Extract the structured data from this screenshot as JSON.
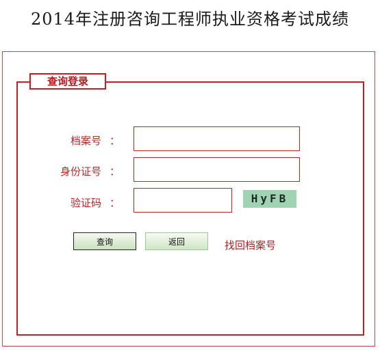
{
  "page": {
    "title": "2014年注册咨询工程师执业资格考试成绩"
  },
  "login": {
    "legend": "查询登录",
    "archive_label": "档案号",
    "id_label": "身份证号",
    "captcha_label": "验证码",
    "colon": "：",
    "archive_value": "",
    "id_value": "",
    "captcha_value": "",
    "captcha_text": "HyFB",
    "submit_label": "查询",
    "back_label": "返回",
    "recover_link": "找回档案号"
  },
  "colors": {
    "accent_red": "#c41e24",
    "label_red": "#b02a2a",
    "captcha_bg": "#9fd3b4",
    "button_green": "#c9e2bc"
  }
}
